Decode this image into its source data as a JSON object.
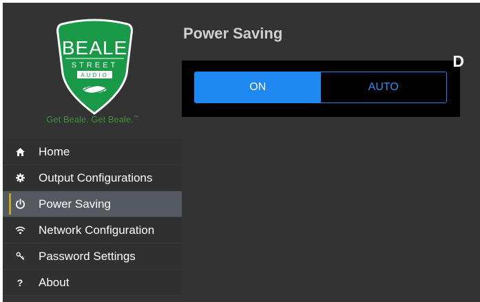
{
  "colors": {
    "accent": "#1e88f0",
    "brand_green": "#3e8f3e",
    "active_marker": "#c9a227",
    "background": "#333333"
  },
  "logo": {
    "line1": "BEALE",
    "line2": "STREET",
    "line3": "AUDIO",
    "tagline": "Get Beale. Get Beale.",
    "trademark": "™"
  },
  "nav": {
    "items": [
      {
        "label": "Home",
        "icon": "home-icon"
      },
      {
        "label": "Output Configurations",
        "icon": "gear-icon"
      },
      {
        "label": "Power Saving",
        "icon": "power-icon",
        "active": true
      },
      {
        "label": "Network Configuration",
        "icon": "wifi-icon"
      },
      {
        "label": "Password Settings",
        "icon": "key-icon"
      },
      {
        "label": "About",
        "icon": "question-icon",
        "glyph": "?"
      }
    ]
  },
  "main": {
    "title": "Power Saving",
    "marker": "D",
    "toggle": {
      "options": [
        "ON",
        "AUTO"
      ],
      "selected": "ON"
    }
  }
}
